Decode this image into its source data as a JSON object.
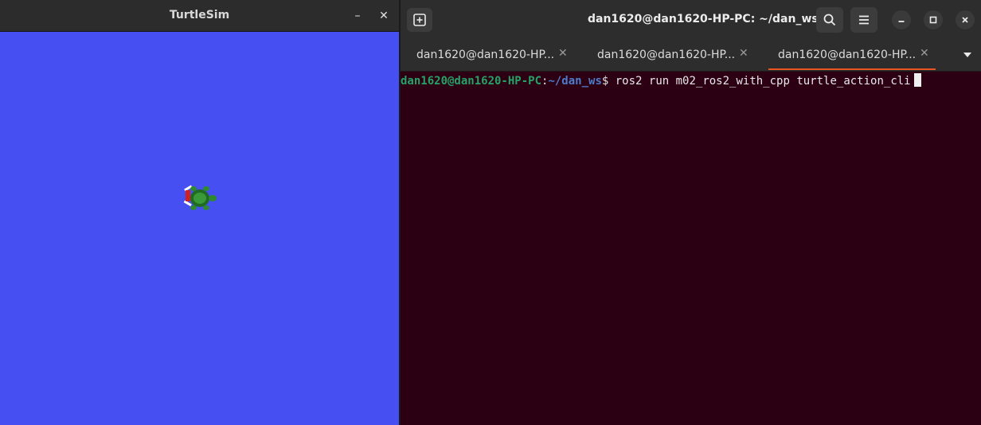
{
  "turtlesim": {
    "title": "TurtleSim",
    "minimize_glyph": "–",
    "close_glyph": "✕",
    "background_color": "#454ff2"
  },
  "terminal": {
    "title": "dan1620@dan1620-HP-PC: ~/dan_ws",
    "tabs": [
      {
        "label": "dan1620@dan1620-HP...",
        "active": false
      },
      {
        "label": "dan1620@dan1620-HP...",
        "active": false
      },
      {
        "label": "dan1620@dan1620-HP...",
        "active": true
      }
    ],
    "tab_close_glyph": "✕",
    "prompt": {
      "user_host": "dan1620@dan1620-HP-PC",
      "colon": ":",
      "path": "~/dan_ws",
      "dollar": "$ ",
      "command": "ros2 run m02_ros2_with_cpp turtle_action_cli"
    },
    "icons": {
      "new_tab": "new-tab-icon",
      "search": "search-icon",
      "menu": "hamburger-menu-icon",
      "minimize": "minimize-icon",
      "maximize": "maximize-icon",
      "close": "close-icon",
      "tab_overflow": "chevron-down-icon"
    },
    "colors": {
      "background": "#2c0012",
      "prompt_user": "#26a269",
      "prompt_path": "#4d7ccb",
      "active_tab_accent": "#e95420"
    }
  }
}
